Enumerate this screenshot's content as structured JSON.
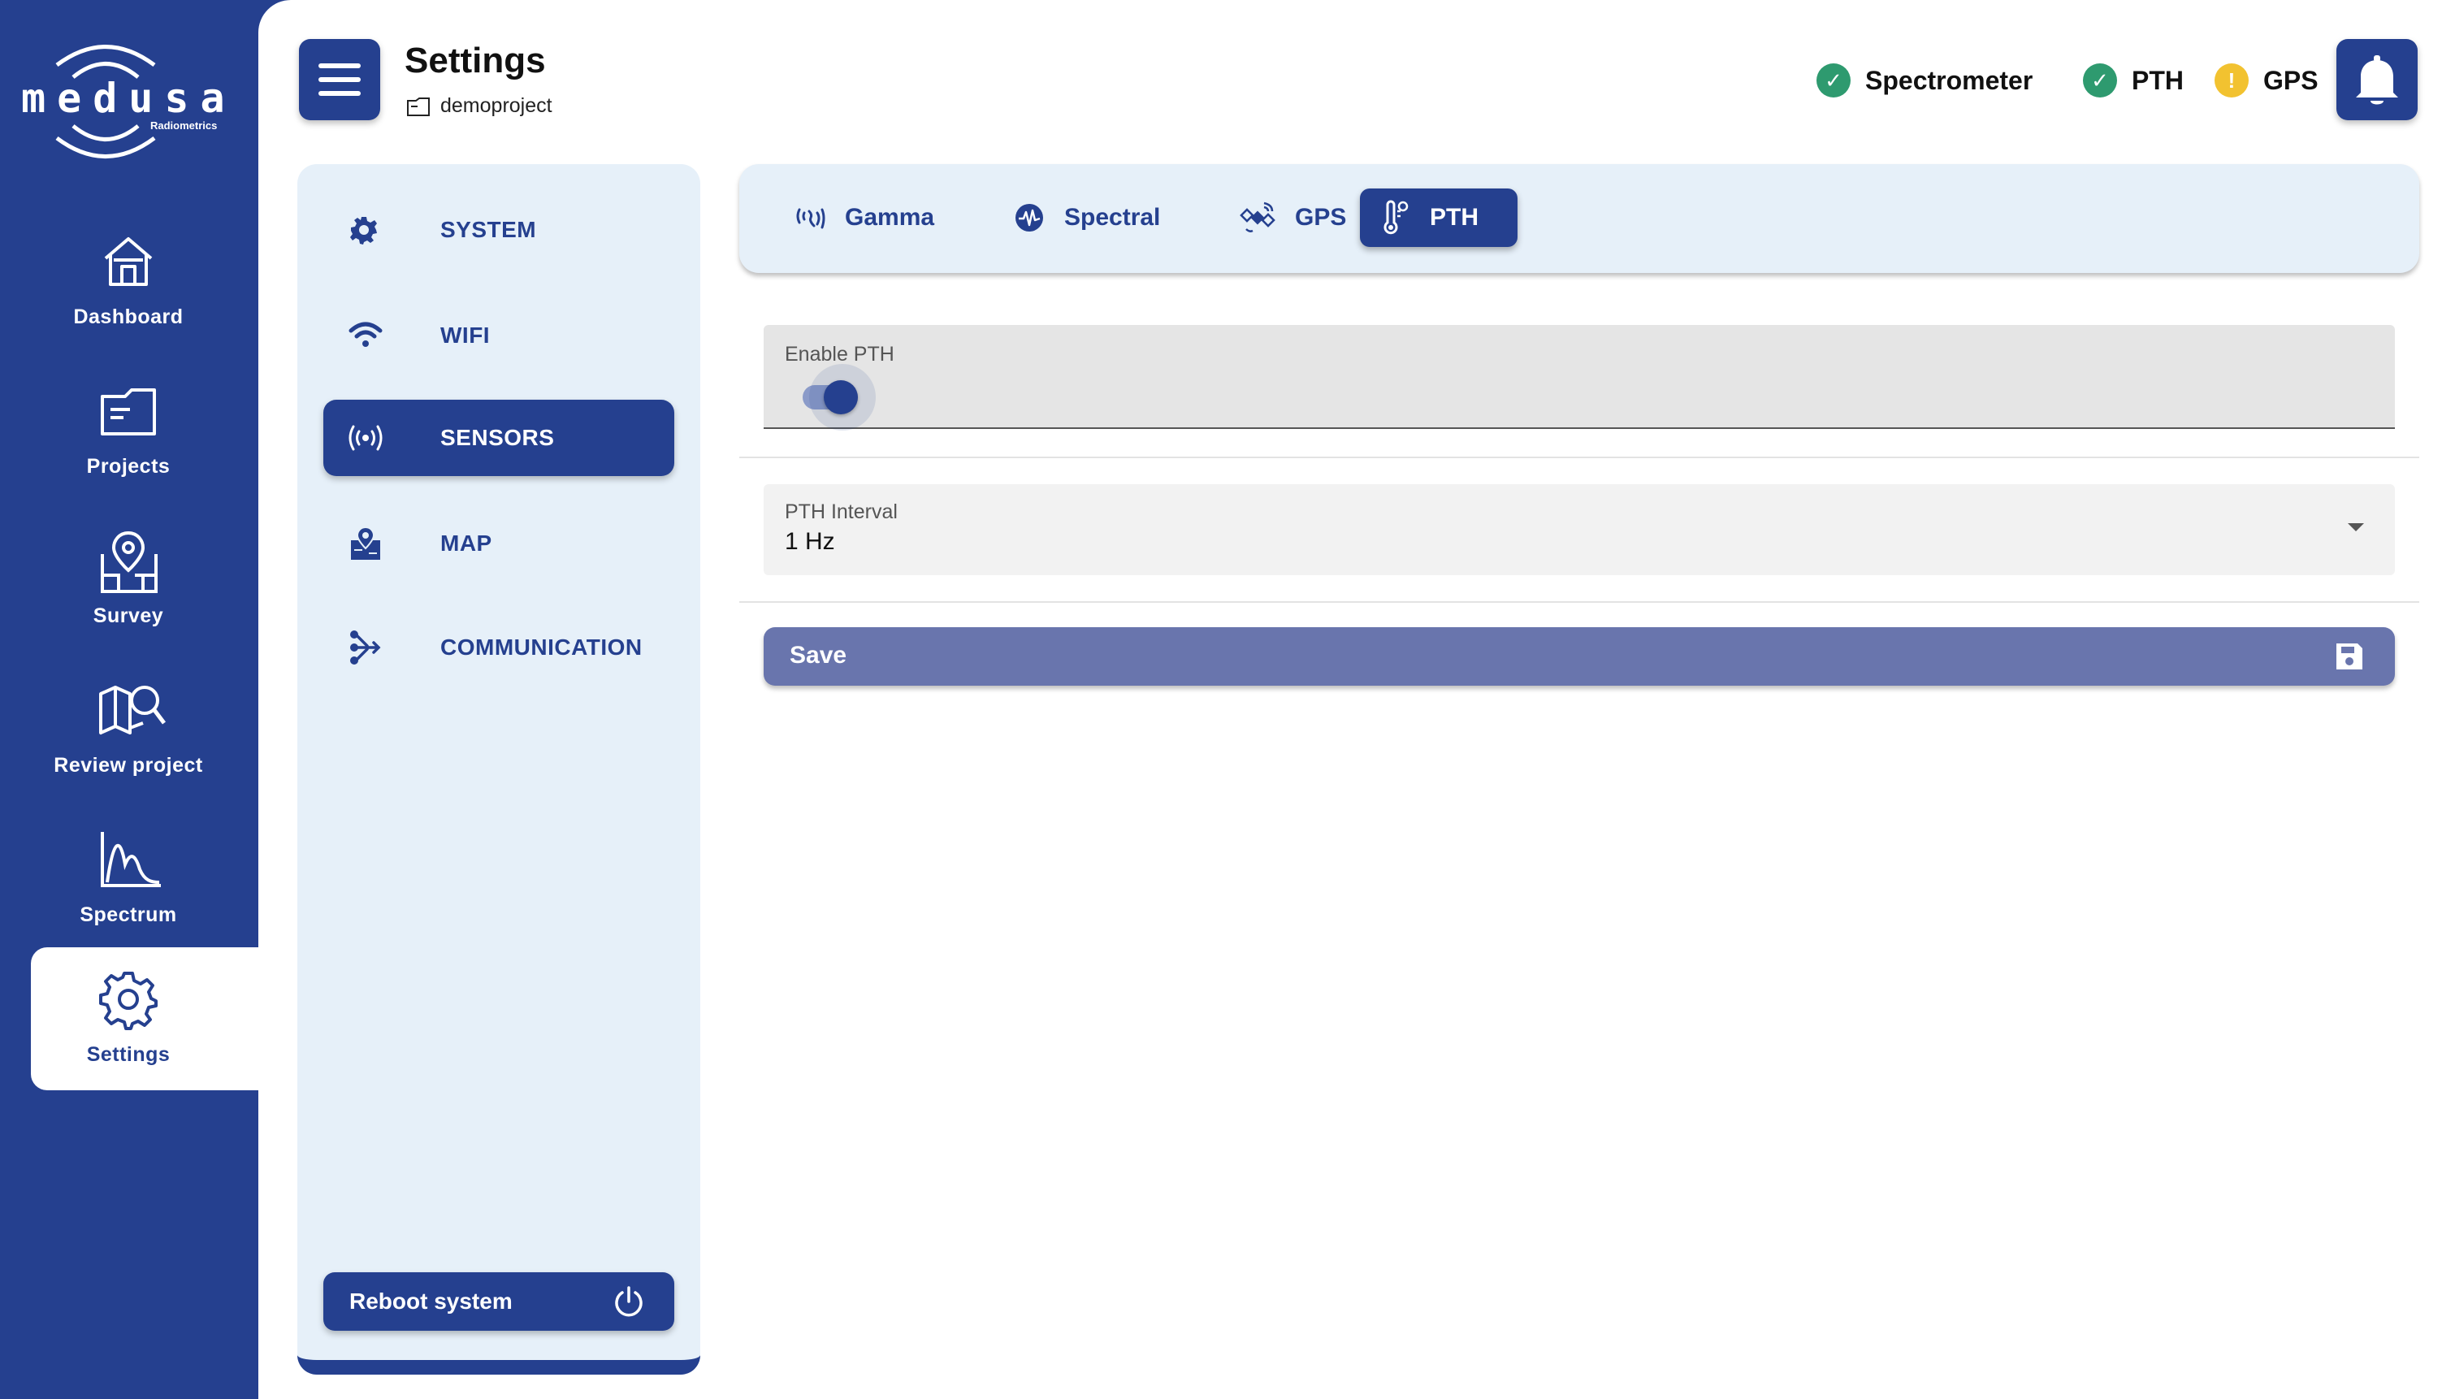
{
  "app": {
    "logo_text": "medusa",
    "logo_subtext": "Radiometrics"
  },
  "nav": {
    "items": [
      {
        "label": "Dashboard",
        "icon": "home-icon"
      },
      {
        "label": "Projects",
        "icon": "folder-icon"
      },
      {
        "label": "Survey",
        "icon": "map-pin-icon"
      },
      {
        "label": "Review project",
        "icon": "map-search-icon"
      },
      {
        "label": "Spectrum",
        "icon": "spectrum-chart-icon"
      },
      {
        "label": "Settings",
        "icon": "gear-icon",
        "active": true
      }
    ]
  },
  "header": {
    "title": "Settings",
    "project": "demoproject"
  },
  "status": {
    "items": [
      {
        "label": "Spectrometer",
        "state": "ok",
        "color": "#2e9a6f"
      },
      {
        "label": "PTH",
        "state": "ok",
        "color": "#2e9a6f"
      },
      {
        "label": "GPS",
        "state": "warning",
        "color": "#f2c230"
      }
    ],
    "ok_symbol": "✓",
    "warning_symbol": "!"
  },
  "settings_nav": {
    "items": [
      {
        "label": "SYSTEM",
        "icon": "gear-icon"
      },
      {
        "label": "WIFI",
        "icon": "wifi-icon"
      },
      {
        "label": "SENSORS",
        "icon": "sensor-icon",
        "active": true
      },
      {
        "label": "MAP",
        "icon": "map-icon"
      },
      {
        "label": "COMMUNICATION",
        "icon": "share-icon"
      }
    ],
    "reboot_label": "Reboot system"
  },
  "tabs": {
    "items": [
      {
        "label": "Gamma",
        "icon": "gamma-icon"
      },
      {
        "label": "Spectral",
        "icon": "spectral-icon"
      },
      {
        "label": "GPS",
        "icon": "satellite-icon"
      },
      {
        "label": "PTH",
        "icon": "thermometer-icon",
        "active": true
      }
    ]
  },
  "form": {
    "enable_label": "Enable PTH",
    "enable_value": true,
    "interval_label": "PTH Interval",
    "interval_value": "1 Hz",
    "save_label": "Save"
  },
  "colors": {
    "primary": "#25408f",
    "panel": "#e6f0f9",
    "save_button": "#6975ad"
  }
}
